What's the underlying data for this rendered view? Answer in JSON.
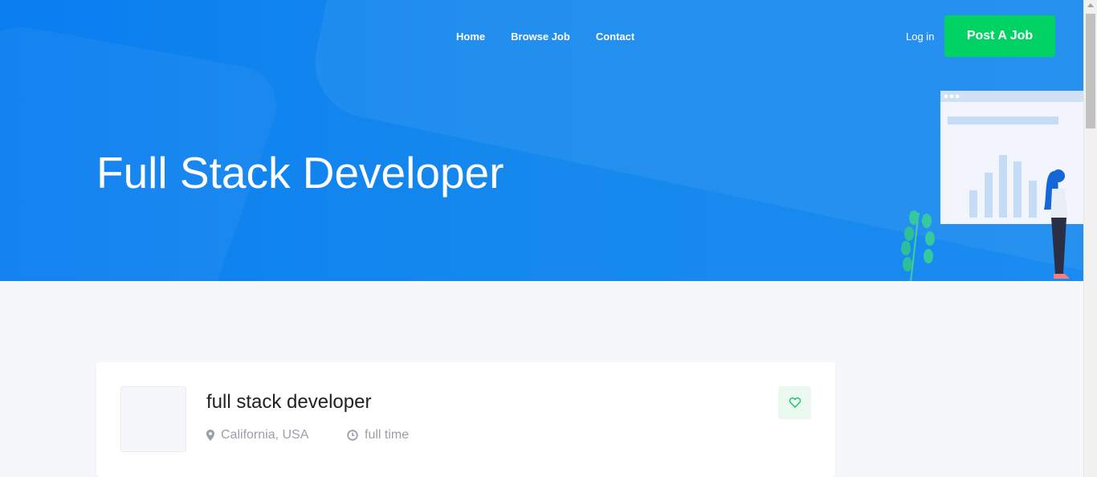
{
  "nav": {
    "items": [
      "Home",
      "Browse Job",
      "Contact"
    ],
    "login": "Log in",
    "post_job": "Post A Job"
  },
  "hero": {
    "title": "Full Stack Developer"
  },
  "job": {
    "title": "full stack developer",
    "location": "California, USA",
    "type": "full time"
  },
  "colors": {
    "hero_blue": "#0a7ef0",
    "accent_green": "#00d363",
    "page_bg": "#f5f7fb",
    "fav_bg": "#ebf8ef"
  },
  "icons": [
    "location-pin-icon",
    "clock-icon",
    "heart-icon"
  ]
}
